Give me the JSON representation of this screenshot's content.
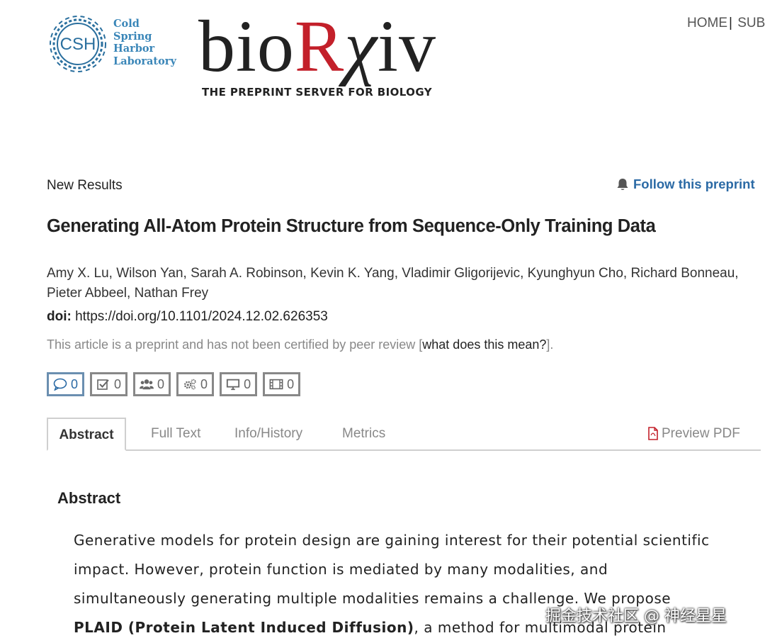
{
  "header": {
    "csh_logo_abbrev": "CSH",
    "csh_logo_lines": [
      "Cold",
      "Spring",
      "Harbor",
      "Laboratory"
    ],
    "brand_bio": "bio",
    "brand_r": "R",
    "brand_chi": "χ",
    "brand_iv": "iv",
    "tagline": "THE PREPRINT SERVER FOR BIOLOGY",
    "nav_home": "HOME",
    "nav_sep": "|",
    "nav_submit_partial": "SUBI"
  },
  "article": {
    "category": "New Results",
    "follow_label": "Follow this preprint",
    "title": "Generating All-Atom Protein Structure from Sequence-Only Training Data",
    "authors_line1": "Amy X. Lu, Wilson Yan, Sarah A. Robinson, Kevin K. Yang, Vladimir Gligorijevic, Kyunghyun Cho, Richard Bonneau,",
    "authors_line2": "Pieter Abbeel, Nathan Frey",
    "doi_label": "doi:",
    "doi_value": "https://doi.org/10.1101/2024.12.02.626353",
    "preprint_note_prefix": "This article is a preprint and has not been certified by peer review [",
    "preprint_note_link": "what does this mean?",
    "preprint_note_suffix": "]."
  },
  "metric_counts": {
    "comments": "0",
    "reviews": "0",
    "community": "0",
    "automated": "0",
    "tweets": "0",
    "media": "0"
  },
  "tabs": {
    "abstract": "Abstract",
    "full_text": "Full Text",
    "info_history": "Info/History",
    "metrics": "Metrics",
    "preview_pdf": "Preview PDF"
  },
  "abstract": {
    "heading": "Abstract",
    "line1": "Generative models for protein design are gaining interest for their potential scientific",
    "line2": "impact. However, protein function is mediated by many modalities, and",
    "line3": "simultaneously generating multiple modalities remains a challenge. We propose",
    "line4_bold": "PLAID (Protein Latent Induced Diffusion)",
    "line4_rest": ", a method for multimodal protein"
  },
  "watermark": "掘金技术社区 @ 神经星星",
  "colors": {
    "brand_red": "#c3202a",
    "link_blue": "#2b6aa5",
    "csh_blue": "#2a6f9e"
  },
  "icons": [
    "csh-logo",
    "bell-icon",
    "comment-icon",
    "checkbox-icon",
    "users-icon",
    "gears-icon",
    "monitor-icon",
    "film-icon",
    "pdf-file-icon"
  ]
}
